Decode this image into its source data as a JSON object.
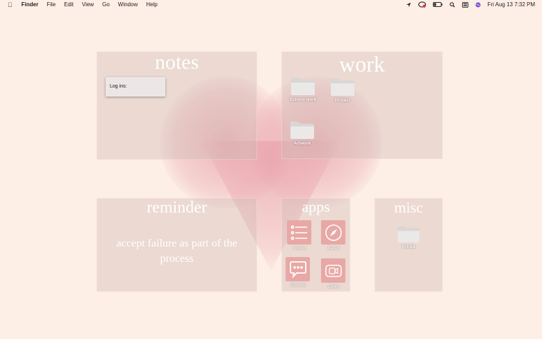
{
  "menubar": {
    "app_name": "Finder",
    "items": [
      "File",
      "Edit",
      "View",
      "Go",
      "Window",
      "Help"
    ],
    "datetime": "Fri Aug 13  7:32 PM"
  },
  "panels": {
    "notes": {
      "title": "notes",
      "widget_text": "Log ins:"
    },
    "work": {
      "title": "work",
      "folders": [
        "School work",
        "Project",
        "Artwork"
      ]
    },
    "reminder": {
      "title": "reminder",
      "text": "accept failure as part of the process"
    },
    "apps": {
      "title": "apps",
      "items": [
        "Notion",
        "Safari",
        "Discord",
        "Zoom"
      ]
    },
    "misc": {
      "title": "misc",
      "folders": [
        "Prints"
      ]
    }
  },
  "colors": {
    "background": "#fdeee6",
    "panel": "#cdb9b2",
    "app_tile": "#e8a8a5",
    "heart": "#e8a0aa"
  }
}
